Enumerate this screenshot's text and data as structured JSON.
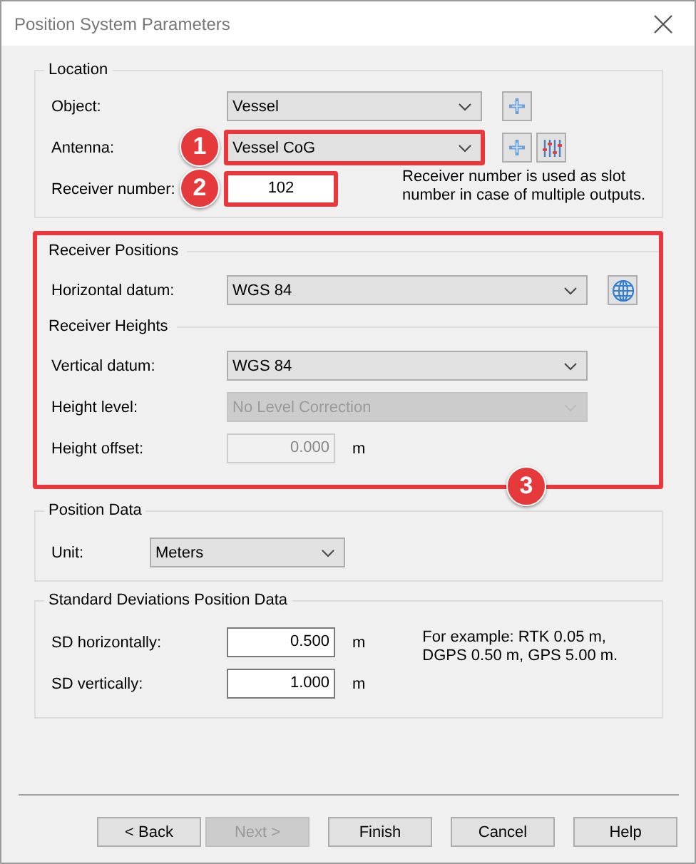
{
  "window": {
    "title": "Position System Parameters"
  },
  "location": {
    "title": "Location",
    "rows": [
      {
        "kind": "combo",
        "label": "Object:",
        "value": "Vessel",
        "disabled": false,
        "highlighted": false,
        "icons": [
          {
            "kind": "plus"
          }
        ]
      },
      {
        "kind": "combo",
        "label": "Antenna:",
        "value": "Vessel CoG",
        "disabled": false,
        "highlighted": true,
        "callout": "1",
        "icons": [
          {
            "kind": "plus"
          },
          {
            "kind": "sliders"
          }
        ]
      },
      {
        "kind": "input",
        "label": "Receiver number:",
        "value": "102",
        "disabled": false,
        "highlighted": true,
        "callout": "2",
        "note": "Receiver number is used as slot number in case of multiple outputs."
      }
    ]
  },
  "receiver": {
    "highlighted": true,
    "callout": "3",
    "groups": [
      {
        "title": "Receiver Positions",
        "rows": [
          {
            "kind": "combo",
            "label": "Horizontal datum:",
            "value": "WGS 84",
            "disabled": false,
            "highlighted": false,
            "icons": [
              {
                "kind": "globe"
              }
            ]
          }
        ]
      },
      {
        "title": "Receiver Heights",
        "rows": [
          {
            "kind": "combo",
            "label": "Vertical datum:",
            "value": "WGS 84",
            "disabled": false,
            "highlighted": false
          },
          {
            "kind": "combo",
            "label": "Height level:",
            "value": "No Level Correction",
            "disabled": true,
            "highlighted": false
          },
          {
            "kind": "input",
            "label": "Height offset:",
            "value": "0.000",
            "disabled": true,
            "highlighted": false,
            "unit": "m"
          }
        ]
      }
    ]
  },
  "position_data": {
    "title": "Position Data",
    "rows": [
      {
        "kind": "combo",
        "label": "Unit:",
        "value": "Meters",
        "disabled": false,
        "highlighted": false
      }
    ]
  },
  "std_dev": {
    "title": "Standard Deviations Position Data",
    "note": "For example: RTK 0.05 m, DGPS 0.50 m, GPS 5.00 m.",
    "rows": [
      {
        "kind": "input",
        "label": "SD horizontally:",
        "value": "0.500",
        "disabled": false,
        "highlighted": false,
        "unit": "m"
      },
      {
        "kind": "input",
        "label": "SD vertically:",
        "value": "1.000",
        "disabled": false,
        "highlighted": false,
        "unit": "m"
      }
    ]
  },
  "buttons": [
    {
      "label": "< Back",
      "disabled": false
    },
    {
      "label": "Next >",
      "disabled": true
    },
    {
      "label": "Finish",
      "disabled": false
    },
    {
      "label": "Cancel",
      "disabled": false
    },
    {
      "label": "Help",
      "disabled": false
    }
  ]
}
